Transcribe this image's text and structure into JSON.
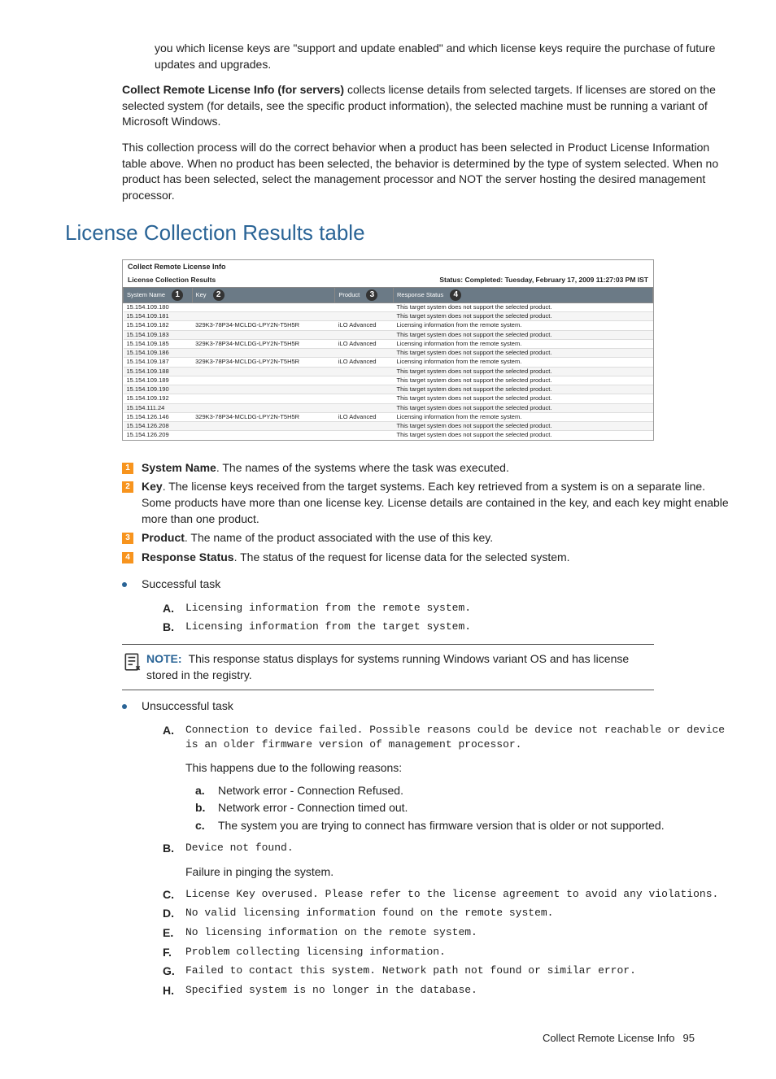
{
  "intro": {
    "p1": "you which license keys are \"support and update enabled\" and which license keys require the purchase of future updates and upgrades.",
    "p2_bold": "Collect Remote License Info (for servers)",
    "p2_rest": " collects license details from selected targets. If licenses are stored on the selected system (for details, see the specific product information), the selected machine must be running a variant of Microsoft Windows.",
    "p3": "This collection process will do the correct behavior when a product has been selected in Product License Information table above. When no product has been selected, the behavior is determined by the type of system selected. When no product has been selected, select the management processor and NOT the server hosting the desired management processor."
  },
  "heading": "License Collection Results table",
  "screenshot": {
    "title": "Collect Remote License Info",
    "subtitle": "License Collection Results",
    "status_label": "Status:",
    "status_value": "Completed: Tuesday, February 17, 2009 11:27:03 PM IST",
    "cols": {
      "c1": "System Name",
      "c2": "Key",
      "c3": "Product",
      "c4": "Response Status"
    },
    "rows": [
      {
        "sys": "15.154.109.180",
        "key": "",
        "prod": "",
        "resp": "This target system does not support the selected product."
      },
      {
        "sys": "15.154.109.181",
        "key": "",
        "prod": "",
        "resp": "This target system does not support the selected product."
      },
      {
        "sys": "15.154.109.182",
        "key": "329K3-78P34-MCLDG-LPY2N-T5H5R",
        "prod": "iLO Advanced",
        "resp": "Licensing information from the remote system."
      },
      {
        "sys": "15.154.109.183",
        "key": "",
        "prod": "",
        "resp": "This target system does not support the selected product."
      },
      {
        "sys": "15.154.109.185",
        "key": "329K3-78P34-MCLDG-LPY2N-T5H5R",
        "prod": "iLO Advanced",
        "resp": "Licensing information from the remote system."
      },
      {
        "sys": "15.154.109.186",
        "key": "",
        "prod": "",
        "resp": "This target system does not support the selected product."
      },
      {
        "sys": "15.154.109.187",
        "key": "329K3-78P34-MCLDG-LPY2N-T5H5R",
        "prod": "iLO Advanced",
        "resp": "Licensing information from the remote system."
      },
      {
        "sys": "15.154.109.188",
        "key": "",
        "prod": "",
        "resp": "This target system does not support the selected product."
      },
      {
        "sys": "15.154.109.189",
        "key": "",
        "prod": "",
        "resp": "This target system does not support the selected product."
      },
      {
        "sys": "15.154.109.190",
        "key": "",
        "prod": "",
        "resp": "This target system does not support the selected product."
      },
      {
        "sys": "15.154.109.192",
        "key": "",
        "prod": "",
        "resp": "This target system does not support the selected product."
      },
      {
        "sys": "15.154.111.24",
        "key": "",
        "prod": "",
        "resp": "This target system does not support the selected product."
      },
      {
        "sys": "15.154.126.146",
        "key": "329K3-78P34-MCLDG-LPY2N-T5H5R",
        "prod": "iLO Advanced",
        "resp": "Licensing information from the remote system."
      },
      {
        "sys": "15.154.126.208",
        "key": "",
        "prod": "",
        "resp": "This target system does not support the selected product."
      },
      {
        "sys": "15.154.126.209",
        "key": "",
        "prod": "",
        "resp": "This target system does not support the selected product."
      }
    ]
  },
  "legend": {
    "i1": {
      "num": "1",
      "bold": "System Name",
      "text": ". The names of the systems where the task was executed."
    },
    "i2": {
      "num": "2",
      "bold": "Key",
      "text": ". The license keys received from the target systems. Each key retrieved from a system is on a separate line. Some products have more than one license key. License details are contained in the key, and each key might enable more than one product."
    },
    "i3": {
      "num": "3",
      "bold": "Product",
      "text": ". The name of the product associated with the use of this key."
    },
    "i4": {
      "num": "4",
      "bold": "Response Status",
      "text": ". The status of the request for license data for the selected system."
    }
  },
  "success": {
    "label": "Successful task",
    "a_letter": "A.",
    "a": "Licensing information from the remote system.",
    "b_letter": "B.",
    "b": "Licensing information from the target system."
  },
  "note": {
    "label": "NOTE:",
    "text": "This response status displays for systems running Windows variant OS and has license stored in the registry."
  },
  "fail": {
    "label": "Unsuccessful task",
    "a_letter": "A.",
    "a": "Connection to device failed. Possible reasons could be device not reachable or device is an older firmware version of management processor.",
    "a_desc": "This happens due to the following reasons:",
    "aa_l": "a.",
    "aa": "Network error - Connection Refused.",
    "ab_l": "b.",
    "ab": "Network error - Connection timed out.",
    "ac_l": "c.",
    "ac": "The system you are trying to connect has firmware version that is older or not supported.",
    "b_letter": "B.",
    "b": "Device not found.",
    "b_desc": "Failure in pinging the system.",
    "c_letter": "C.",
    "c": "License Key overused. Please refer to the license agreement to avoid any violations.",
    "d_letter": "D.",
    "d": "No valid licensing information found on the remote system.",
    "e_letter": "E.",
    "e": "No licensing information on the remote system.",
    "f_letter": "F.",
    "f": "Problem collecting licensing information.",
    "g_letter": "G.",
    "g": "Failed to contact this system. Network path not found or similar error.",
    "h_letter": "H.",
    "h": "Specified system is no longer in the database."
  },
  "footer": {
    "title": "Collect Remote License Info",
    "page": "95"
  }
}
